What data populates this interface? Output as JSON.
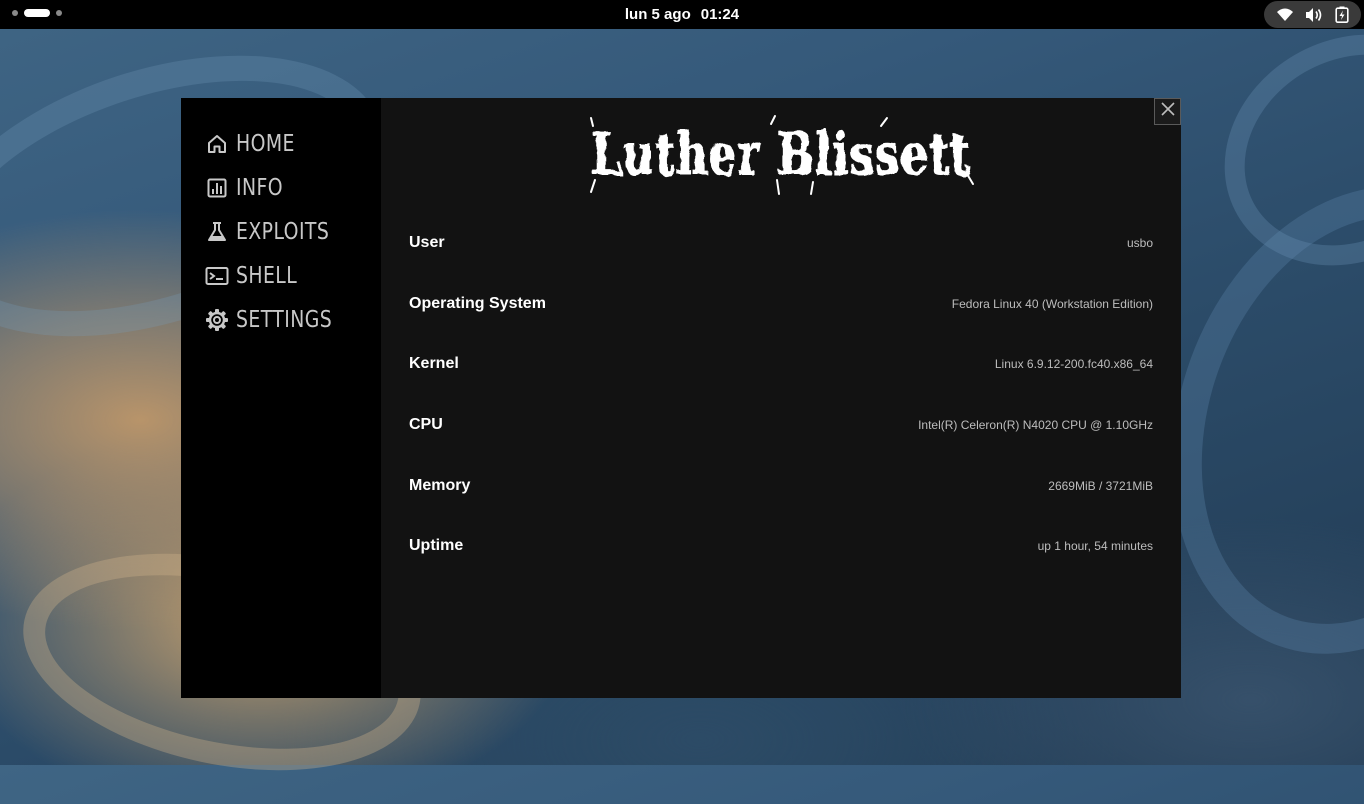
{
  "topbar": {
    "date": "lun 5 ago",
    "time": "01:24",
    "status_icons": [
      "wifi-icon",
      "volume-icon",
      "battery-charging-icon"
    ]
  },
  "app": {
    "logo_text": "Luther Blissett",
    "close_label": "×",
    "nav": [
      {
        "label": "HOME",
        "icon": "home-icon"
      },
      {
        "label": "INFO",
        "icon": "chart-icon"
      },
      {
        "label": "EXPLOITS",
        "icon": "flask-icon"
      },
      {
        "label": "SHELL",
        "icon": "terminal-icon"
      },
      {
        "label": "SETTINGS",
        "icon": "gear-icon"
      }
    ],
    "info": [
      {
        "label": "User",
        "value": "usbo"
      },
      {
        "label": "Operating System",
        "value": "Fedora Linux 40 (Workstation Edition)"
      },
      {
        "label": "Kernel",
        "value": "Linux 6.9.12-200.fc40.x86_64"
      },
      {
        "label": "CPU",
        "value": "Intel(R) Celeron(R) N4020 CPU @ 1.10GHz"
      },
      {
        "label": "Memory",
        "value": "2669MiB / 3721MiB"
      },
      {
        "label": "Uptime",
        "value": "up 1 hour, 54 minutes"
      }
    ]
  }
}
